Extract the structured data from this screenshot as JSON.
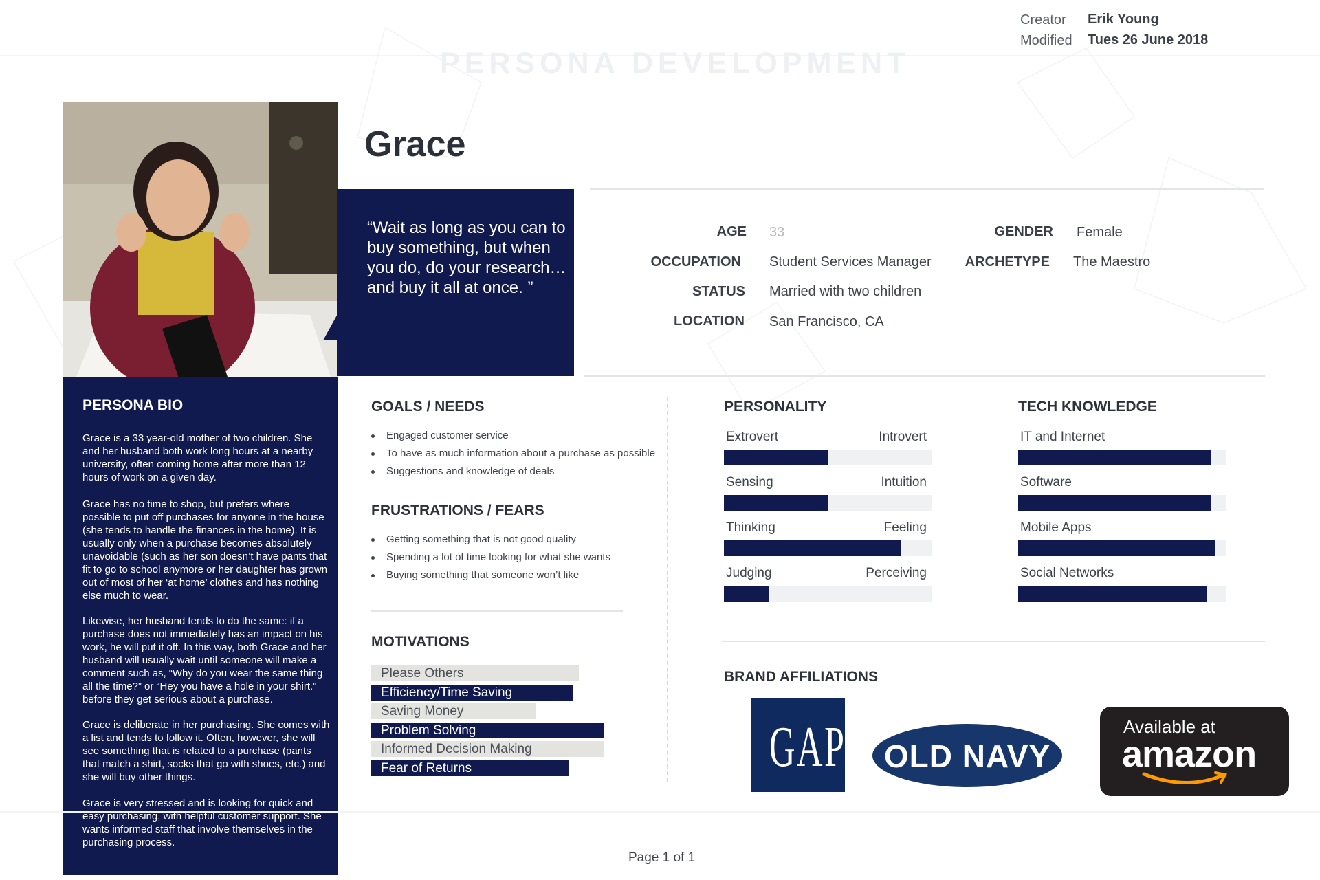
{
  "header": {
    "creator_label": "Creator",
    "creator_value": "Erik Young",
    "modified_label": "Modified",
    "modified_value": "Tues 26 June 2018",
    "watermark": "PERSONA DEVELOPMENT"
  },
  "persona": {
    "name": "Grace",
    "quote": "“Wait as long as you can to buy something, but when you do, do your research…and buy it all at once.  ”",
    "attributes": {
      "age_label": "AGE",
      "age_value": "33",
      "gender_label": "GENDER",
      "gender_value": "Female",
      "occupation_label": "OCCUPATION",
      "occupation_value": "Student Services Manager",
      "archetype_label": "ARCHETYPE",
      "archetype_value": "The Maestro",
      "status_label": "STATUS",
      "status_value": "Married with two children",
      "location_label": "LOCATION",
      "location_value": "San Francisco, CA"
    }
  },
  "bio": {
    "title": "PERSONA BIO",
    "paragraphs": [
      "Grace is a 33 year-old mother of two children. She and her  husband both work long hours at a nearby university, often coming home after more than 12 hours of work on a given day.",
      "Grace has no time to shop, but prefers where possible to put off purchases for anyone in the house (she tends to handle the finances in the home). It is usually only when a purchase becomes absolutely unavoidable (such as her son doesn’t have pants that fit to go to school anymore or her daughter has grown out of most of her ‘at home’ clothes and has nothing else much to wear.",
      "Likewise, her husband tends to do the same: if a purchase does not immediately has an impact on his work, he will put it off. In this way, both Grace and her husband will usually wait until someone will make a comment such as, “Why do you wear the same thing all the time?” or “Hey you have a hole in your shirt.” before they get serious about a purchase.",
      "Grace is deliberate in her purchasing. She comes with a list and tends to follow it. Often, however, she will see something that is related to a purchase (pants that match a shirt, socks that go with shoes, etc.) and she will buy other things.",
      "Grace is very stressed and is looking for quick and easy purchasing, with helpful customer support. She wants informed staff that involve themselves in the purchasing process."
    ]
  },
  "goals": {
    "title": "GOALS / NEEDS",
    "items": [
      "Engaged customer service",
      "To have as much information about a purchase as possible",
      "Suggestions and knowledge of deals"
    ]
  },
  "frustrations": {
    "title": "FRUSTRATIONS / FEARS",
    "items": [
      "Getting something that is not good quality",
      "Spending a lot of time looking for what she wants",
      "Buying something that someone won’t like"
    ]
  },
  "motivations": {
    "title": "MOTIVATIONS",
    "items": [
      {
        "label": "Please Others",
        "level": 0.82,
        "style": "light"
      },
      {
        "label": "Efficiency/Time Saving",
        "level": 0.8,
        "style": "dark"
      },
      {
        "label": "Saving Money",
        "level": 0.65,
        "style": "light"
      },
      {
        "label": "Problem Solving",
        "level": 0.92,
        "style": "dark"
      },
      {
        "label": "Informed Decision Making",
        "level": 0.92,
        "style": "light"
      },
      {
        "label": "Fear of Returns",
        "level": 0.78,
        "style": "dark"
      }
    ]
  },
  "personality": {
    "title": "PERSONALITY",
    "traits": [
      {
        "left": "Extrovert",
        "right": "Introvert",
        "level": 0.5
      },
      {
        "left": "Sensing",
        "right": "Intuition",
        "level": 0.5
      },
      {
        "left": "Thinking",
        "right": "Feeling",
        "level": 0.85
      },
      {
        "left": "Judging",
        "right": "Perceiving",
        "level": 0.22
      }
    ]
  },
  "tech": {
    "title": "TECH KNOWLEDGE",
    "items": [
      {
        "label": "IT and Internet",
        "level": 0.93
      },
      {
        "label": "Software",
        "level": 0.93
      },
      {
        "label": "Mobile Apps",
        "level": 0.95
      },
      {
        "label": "Social Networks",
        "level": 0.91
      }
    ]
  },
  "brands": {
    "title": "BRAND AFFILIATIONS",
    "gap": "GAP",
    "old_navy": "OLD NAVY",
    "amazon_prefix": "Available at",
    "amazon": "amazon"
  },
  "footer": {
    "page": "Page 1 of 1"
  },
  "colors": {
    "navy": "#111a4f",
    "gap_blue": "#0f2a5e",
    "old_navy_blue": "#17376c",
    "amazon_orange": "#ff9900"
  }
}
